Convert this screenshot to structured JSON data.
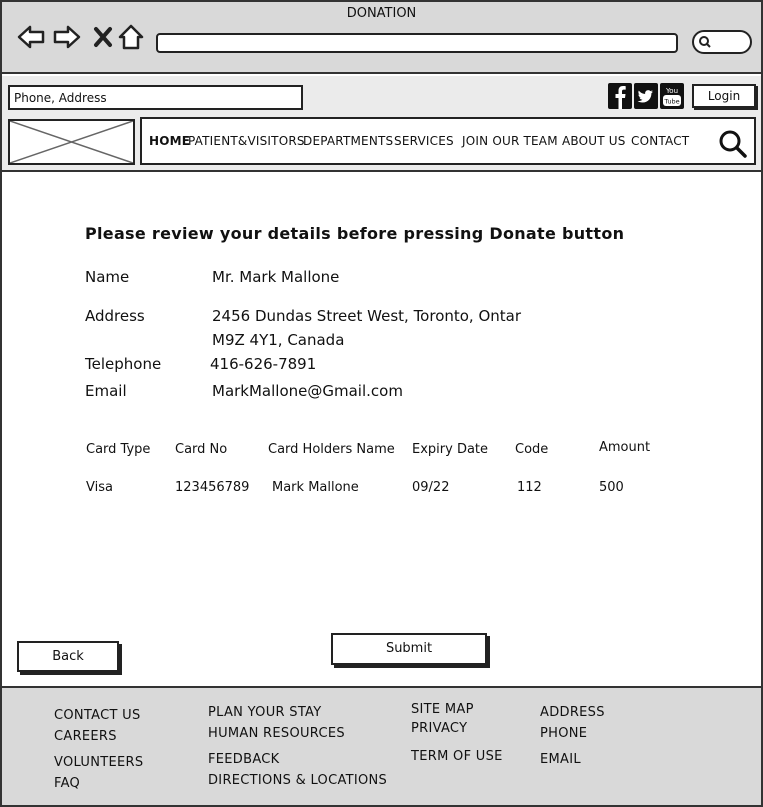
{
  "window": {
    "title": "DONATION"
  },
  "header": {
    "search_input_value": "Phone, Address",
    "login_label": "Login",
    "social": [
      "facebook-icon",
      "twitter-icon",
      "youtube-icon"
    ],
    "nav": {
      "home": "HOME",
      "patient": "PATIENT&VISITORS",
      "departments": "DEPARTMENTS",
      "services": "SERVICES",
      "join": "JOIN OUR TEAM",
      "about": "ABOUT US",
      "contact": "CONTACT"
    }
  },
  "main": {
    "heading": "Please review your details before pressing Donate button",
    "details": {
      "name_label": "Name",
      "name_value": "Mr. Mark Mallone",
      "address_label": "Address",
      "address_line1": "2456 Dundas Street West, Toronto, Ontar",
      "address_line2": "M9Z 4Y1, Canada",
      "telephone_label": "Telephone",
      "telephone_value": "416-626-7891",
      "email_label": "Email",
      "email_value": "MarkMallone@Gmail.com"
    },
    "card": {
      "headers": [
        "Card Type",
        "Card No",
        "Card Holders Name",
        "Expiry Date",
        "Code",
        "Amount"
      ],
      "row": [
        "Visa",
        "123456789",
        "Mark Mallone",
        "09/22",
        "112",
        "500"
      ]
    },
    "back_label": "Back",
    "submit_label": "Submit"
  },
  "footer": {
    "col1": [
      "CONTACT US",
      "CAREERS",
      "VOLUNTEERS",
      "FAQ"
    ],
    "col2": [
      "PLAN YOUR STAY",
      "HUMAN RESOURCES",
      "FEEDBACK",
      "DIRECTIONS & LOCATIONS"
    ],
    "col3": [
      "SITE MAP",
      "PRIVACY",
      "TERM OF USE"
    ],
    "col4": [
      "ADDRESS",
      "PHONE",
      "EMAIL"
    ]
  }
}
